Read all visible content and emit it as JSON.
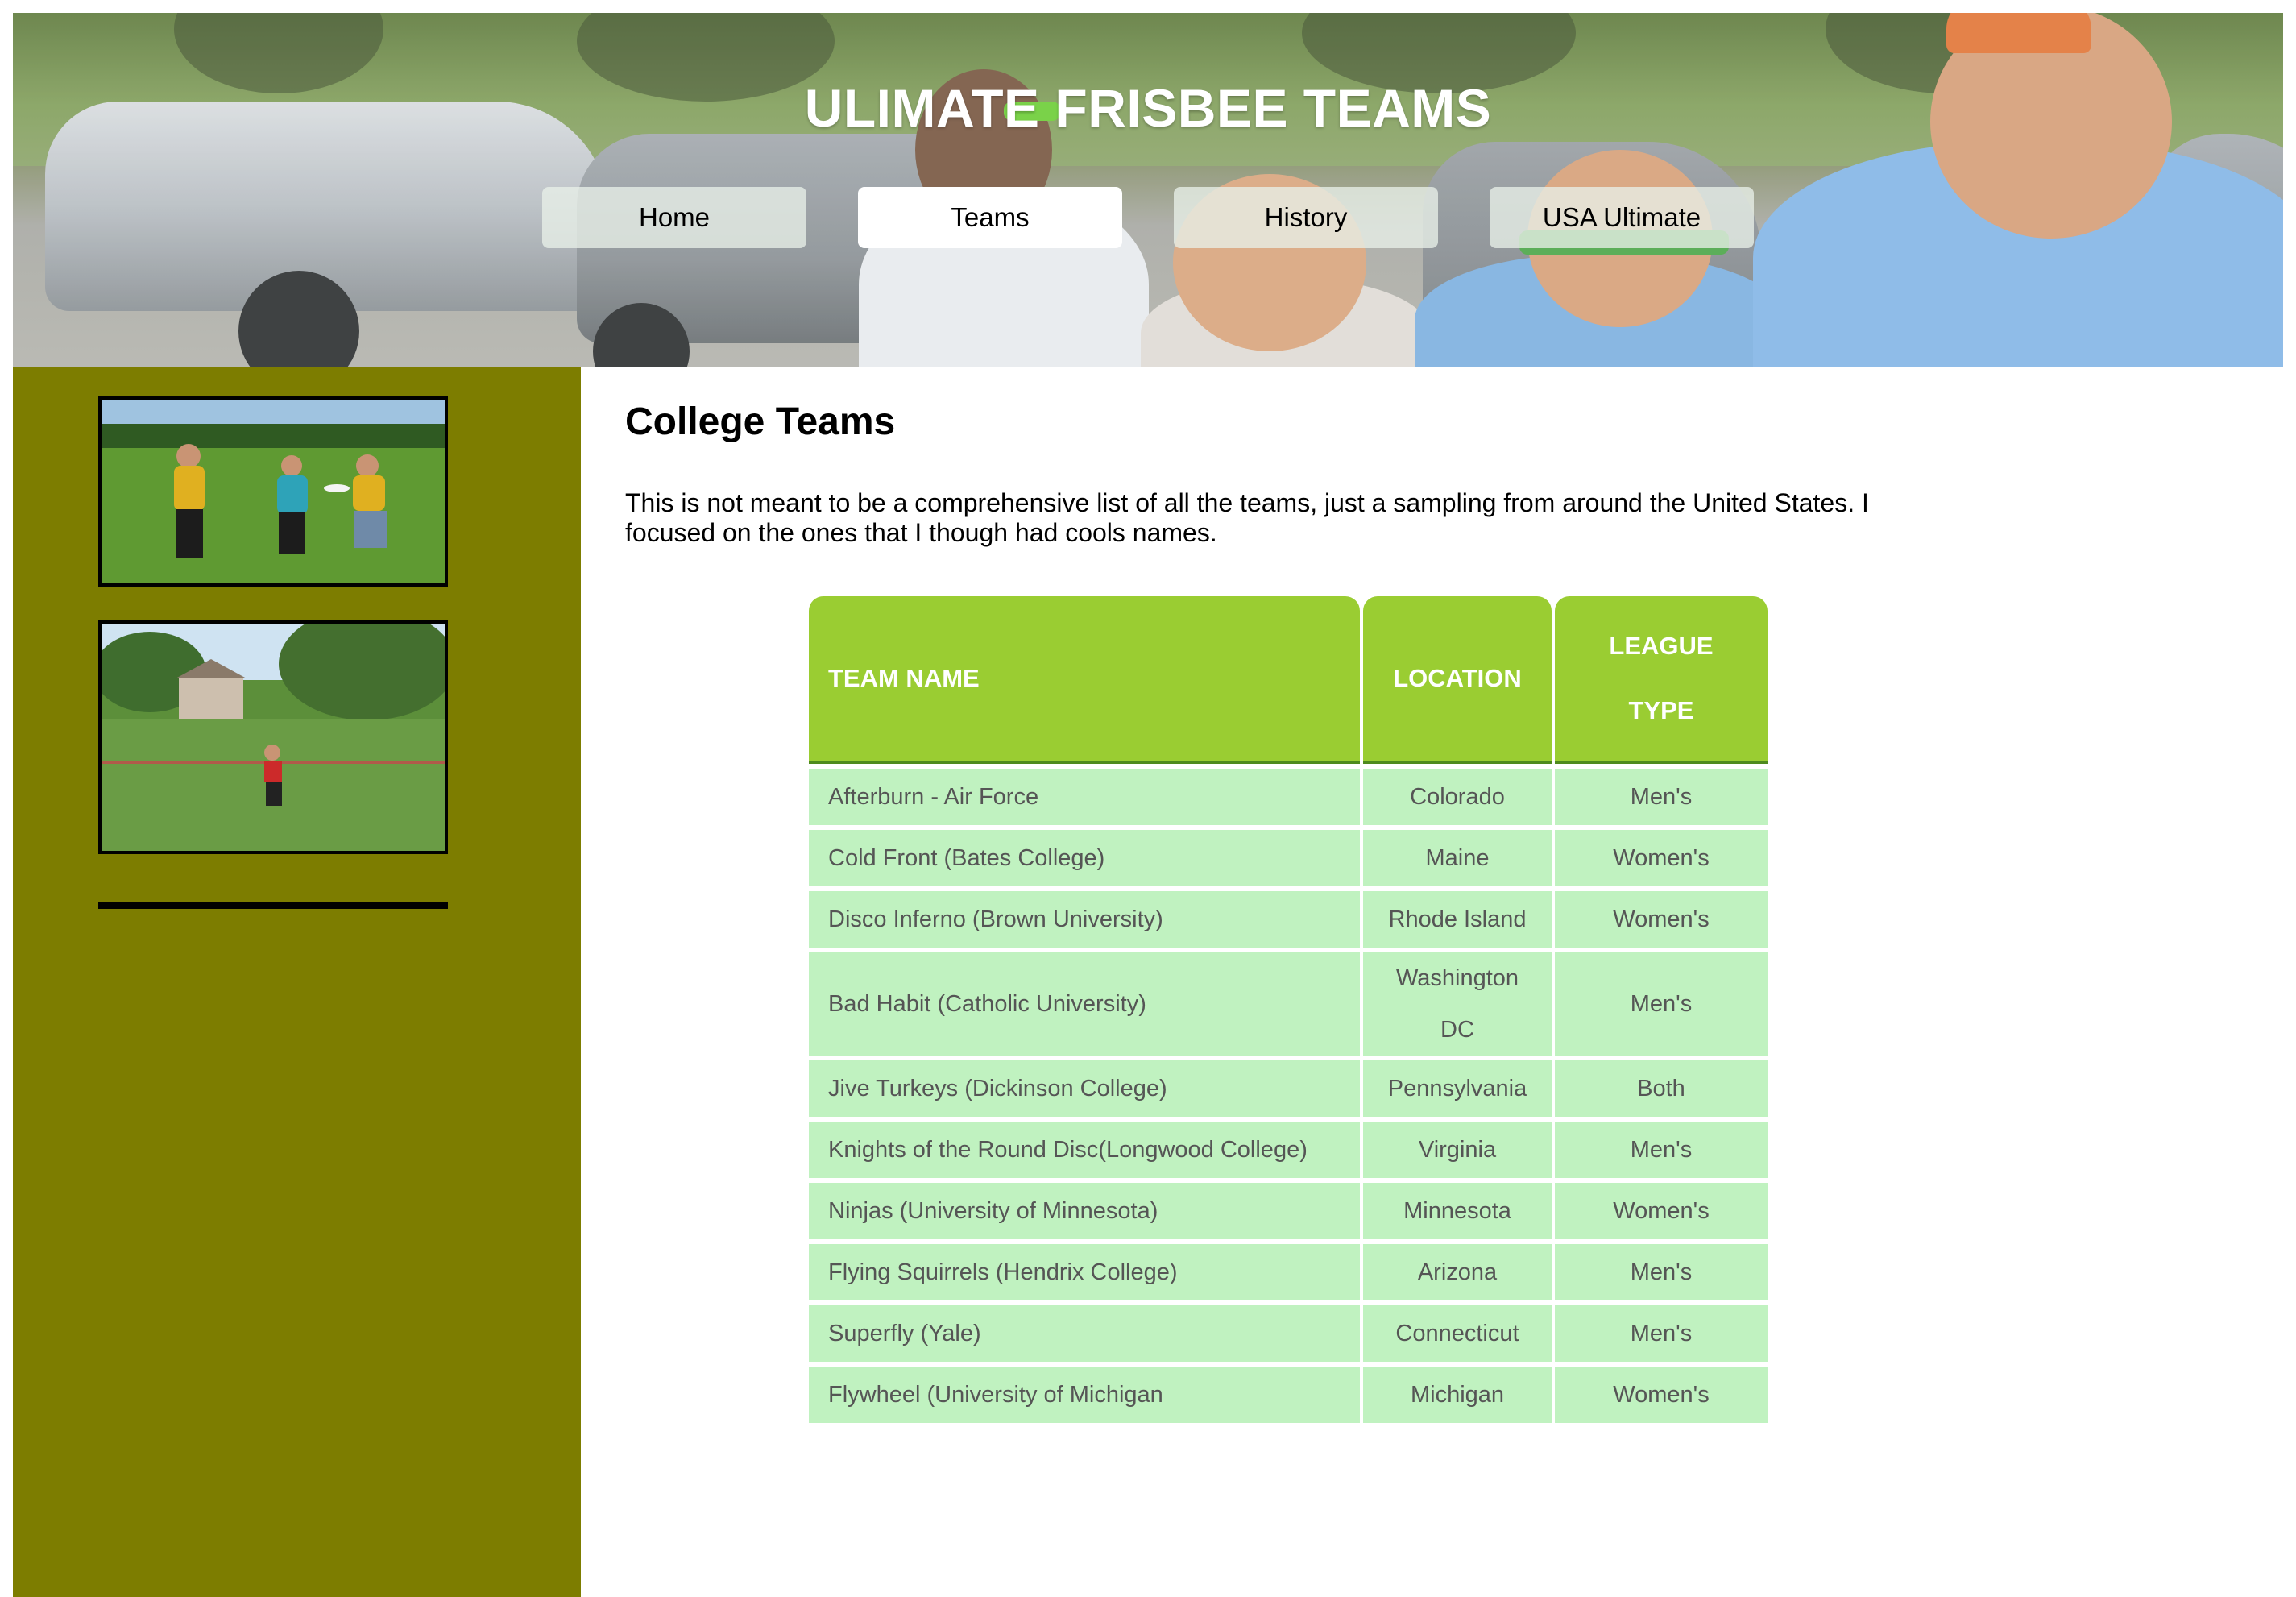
{
  "header": {
    "title": "ULIMATE FRISBEE TEAMS"
  },
  "nav": {
    "items": [
      {
        "label": "Home",
        "active": false
      },
      {
        "label": "Teams",
        "active": true
      },
      {
        "label": "History",
        "active": false
      },
      {
        "label": "USA Ultimate",
        "active": false
      }
    ]
  },
  "main": {
    "heading": "College Teams",
    "intro": "This is not meant to be a comprehensive list of all the teams, just a sampling from around the United States. I focused on the ones that I though had cools names."
  },
  "table": {
    "headers": {
      "team": "TEAM NAME",
      "location": "LOCATION",
      "type": "LEAGUE TYPE"
    },
    "rows": [
      {
        "team": "Afterburn - Air Force",
        "location": "Colorado",
        "type": "Men's"
      },
      {
        "team": "Cold Front (Bates College)",
        "location": "Maine",
        "type": "Women's"
      },
      {
        "team": "Disco Inferno (Brown University)",
        "location": "Rhode Island",
        "type": "Women's"
      },
      {
        "team": "Bad Habit (Catholic University)",
        "location": "Washington DC",
        "type": "Men's"
      },
      {
        "team": "Jive Turkeys (Dickinson College)",
        "location": "Pennsylvania",
        "type": "Both"
      },
      {
        "team": "Knights of the Round Disc(Longwood College)",
        "location": "Virginia",
        "type": "Men's"
      },
      {
        "team": "Ninjas (University of Minnesota)",
        "location": "Minnesota",
        "type": "Women's"
      },
      {
        "team": "Flying Squirrels (Hendrix College)",
        "location": "Arizona",
        "type": "Men's"
      },
      {
        "team": "Superfly (Yale)",
        "location": "Connecticut",
        "type": "Men's"
      },
      {
        "team": "Flywheel (University of Michigan",
        "location": "Michigan",
        "type": "Women's"
      }
    ]
  },
  "colors": {
    "sidebar": "#7d7d00",
    "table_header": "#9acd32",
    "table_cell": "#c0f2c0",
    "cell_text": "#555555"
  }
}
